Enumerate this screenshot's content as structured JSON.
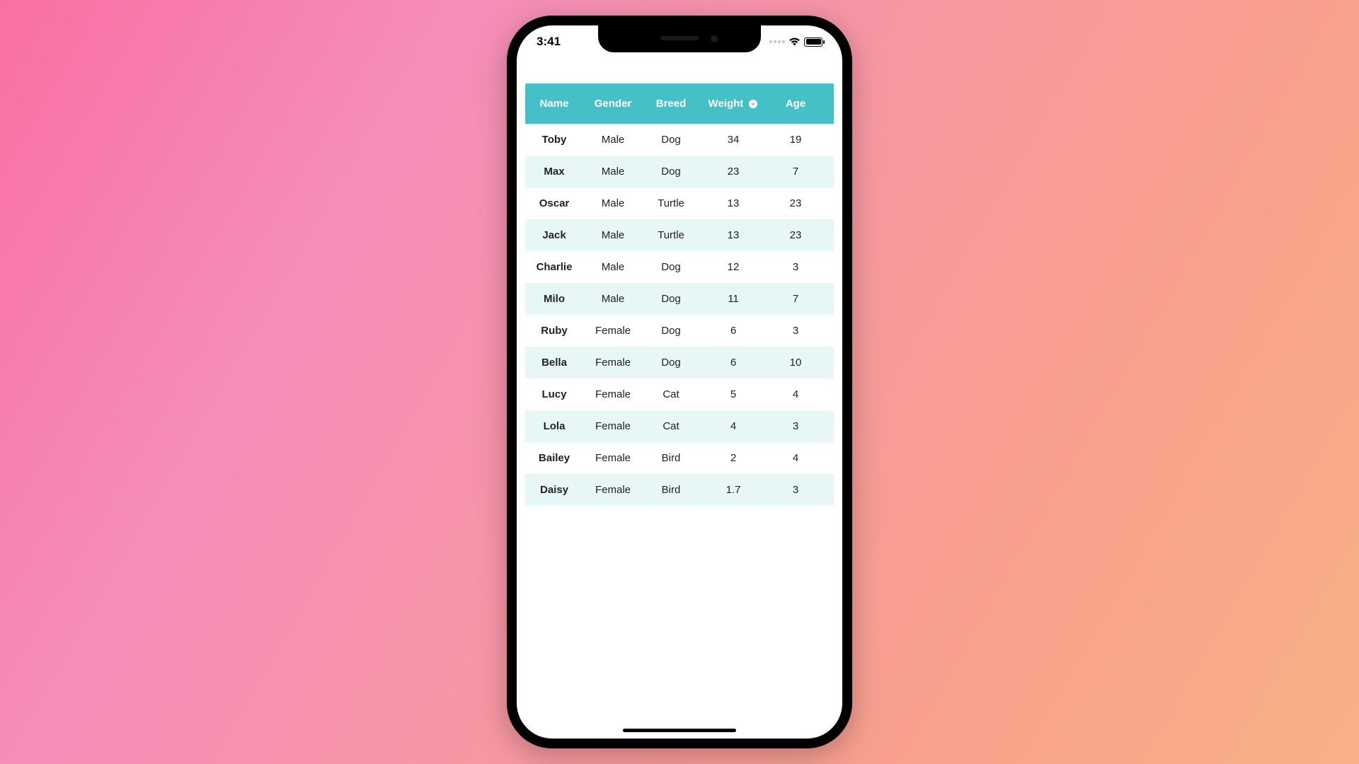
{
  "statusbar": {
    "time": "3:41"
  },
  "table": {
    "headers": {
      "name": "Name",
      "gender": "Gender",
      "breed": "Breed",
      "weight": "Weight",
      "age": "Age"
    },
    "sorted_by": "weight",
    "rows": [
      {
        "name": "Toby",
        "gender": "Male",
        "breed": "Dog",
        "weight": "34",
        "age": "19"
      },
      {
        "name": "Max",
        "gender": "Male",
        "breed": "Dog",
        "weight": "23",
        "age": "7"
      },
      {
        "name": "Oscar",
        "gender": "Male",
        "breed": "Turtle",
        "weight": "13",
        "age": "23"
      },
      {
        "name": "Jack",
        "gender": "Male",
        "breed": "Turtle",
        "weight": "13",
        "age": "23"
      },
      {
        "name": "Charlie",
        "gender": "Male",
        "breed": "Dog",
        "weight": "12",
        "age": "3"
      },
      {
        "name": "Milo",
        "gender": "Male",
        "breed": "Dog",
        "weight": "11",
        "age": "7"
      },
      {
        "name": "Ruby",
        "gender": "Female",
        "breed": "Dog",
        "weight": "6",
        "age": "3"
      },
      {
        "name": "Bella",
        "gender": "Female",
        "breed": "Dog",
        "weight": "6",
        "age": "10"
      },
      {
        "name": "Lucy",
        "gender": "Female",
        "breed": "Cat",
        "weight": "5",
        "age": "4"
      },
      {
        "name": "Lola",
        "gender": "Female",
        "breed": "Cat",
        "weight": "4",
        "age": "3"
      },
      {
        "name": "Bailey",
        "gender": "Female",
        "breed": "Bird",
        "weight": "2",
        "age": "4"
      },
      {
        "name": "Daisy",
        "gender": "Female",
        "breed": "Bird",
        "weight": "1.7",
        "age": "3"
      }
    ]
  },
  "colors": {
    "header_bg": "#46c0c7",
    "row_alt_bg": "#e7f7f5"
  }
}
